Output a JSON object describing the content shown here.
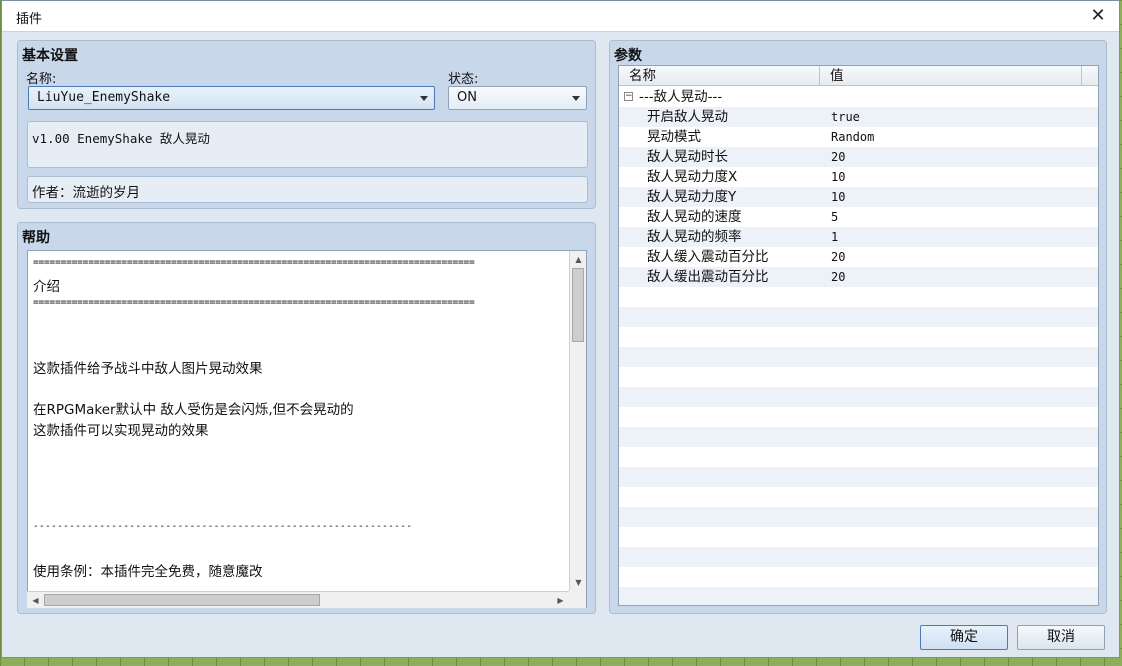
{
  "window": {
    "title": "插件",
    "close_glyph": "✕"
  },
  "basic": {
    "title": "基本设置",
    "name_label": "名称:",
    "name_value": "LiuYue_EnemyShake",
    "status_label": "状态:",
    "status_value": "ON",
    "description": "v1.00 EnemyShake 敌人晃动",
    "author": "作者：流逝的岁月"
  },
  "help": {
    "title": "帮助",
    "lines": [
      "================================================================================",
      "介绍",
      "================================================================================",
      "这款插件给予战斗中敌人图片晃动效果",
      "在RPGMaker默认中 敌人受伤是会闪烁,但不会晃动的",
      "这款插件可以实现晃动的效果",
      "---------------------------------------------------------------",
      "使用条例：本插件完全免费，随意魔改"
    ]
  },
  "params": {
    "title": "参数",
    "col_name": "名称",
    "col_value": "值",
    "group_label": "---敌人晃动---",
    "group_expander": "−",
    "rows": [
      {
        "name": "开启敌人晃动",
        "value": "true"
      },
      {
        "name": "晃动模式",
        "value": "Random"
      },
      {
        "name": "敌人晃动时长",
        "value": "20"
      },
      {
        "name": "敌人晃动力度X",
        "value": "10"
      },
      {
        "name": "敌人晃动力度Y",
        "value": "10"
      },
      {
        "name": "敌人晃动的速度",
        "value": "5"
      },
      {
        "name": "敌人晃动的频率",
        "value": "1"
      },
      {
        "name": "敌人缓入震动百分比",
        "value": "20"
      },
      {
        "name": "敌人缓出震动百分比",
        "value": "20"
      }
    ]
  },
  "footer": {
    "ok_label": "确定",
    "cancel_label": "取消"
  },
  "colors": {
    "accent": "#4a7ab8",
    "panel": "#c8d8ea",
    "window_bg": "#dfe8f1"
  }
}
